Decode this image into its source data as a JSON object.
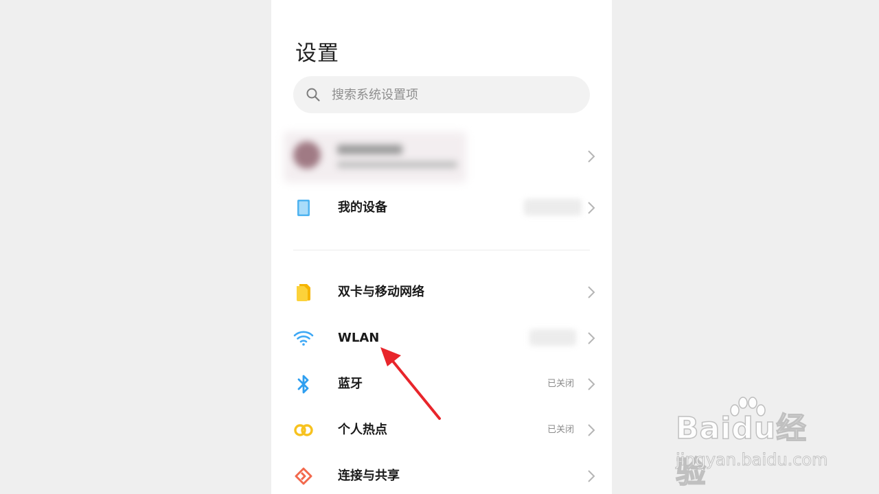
{
  "header": {
    "title": "设置"
  },
  "search": {
    "placeholder": "搜索系统设置项"
  },
  "rows": {
    "my_device": {
      "label": "我的设备"
    },
    "dual_sim": {
      "label": "双卡与移动网络"
    },
    "wlan": {
      "label": "WLAN"
    },
    "bluetooth": {
      "label": "蓝牙",
      "status": "已关闭"
    },
    "hotspot": {
      "label": "个人热点",
      "status": "已关闭"
    },
    "connection": {
      "label": "连接与共享"
    }
  },
  "icons": {
    "search": "search-icon",
    "device": "phone-device-icon",
    "sim": "sim-card-icon",
    "wifi": "wifi-icon",
    "bluetooth": "bluetooth-icon",
    "hotspot": "hotspot-rings-icon",
    "share": "connection-share-icon",
    "chevron": "chevron-right-icon"
  },
  "colors": {
    "device": "#4fb3f0",
    "sim": "#fbc02d",
    "wifi": "#3ea8f5",
    "bluetooth": "#2f9ff0",
    "hotspot": "#f7c21f",
    "share": "#f2684c",
    "annotation_arrow": "#e8252b"
  },
  "watermark": {
    "logo": "Baidu经验",
    "url": "jingyan.baidu.com"
  }
}
